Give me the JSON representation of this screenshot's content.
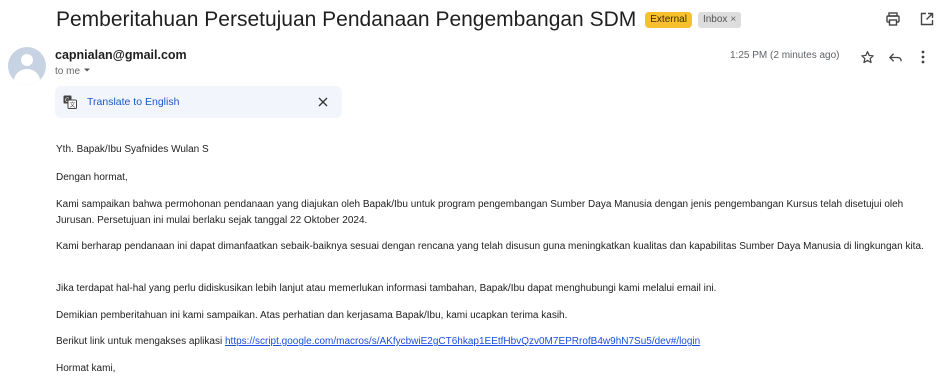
{
  "email": {
    "subject": "Pemberitahuan Persetujuan Pendanaan Pengembangan SDM",
    "labels": {
      "external": "External",
      "inbox": "Inbox"
    },
    "sender": "capnialan@gmail.com",
    "recipient": "to me",
    "time": "1:25 PM (2 minutes ago)",
    "translate": {
      "label": "Translate to English"
    },
    "body": {
      "greeting": "Yth. Bapak/Ibu Syafnides Wulan S",
      "salutation": "Dengan hormat,",
      "para1": "Kami sampaikan bahwa permohonan pendanaan yang diajukan oleh Bapak/Ibu untuk program pengembangan Sumber Daya Manusia dengan jenis pengembangan Kursus telah disetujui oleh Jurusan. Persetujuan ini mulai berlaku sejak tanggal 22 Oktober 2024.",
      "para2": "Kami berharap pendanaan ini dapat dimanfaatkan sebaik-baiknya sesuai dengan rencana yang telah disusun guna meningkatkan kualitas dan kapabilitas Sumber Daya Manusia di lingkungan kita.",
      "para3": "Jika terdapat hal-hal yang perlu didiskusikan lebih lanjut atau memerlukan informasi tambahan, Bapak/Ibu dapat menghubungi kami melalui email ini.",
      "para4": "Demikian pemberitahuan ini kami sampaikan. Atas perhatian dan kerjasama Bapak/Ibu, kami ucapkan terima kasih.",
      "link_prefix": "Berikut link untuk mengakses aplikasi ",
      "link_url": "https://script.google.com/macros/s/AKfycbwiE2gCT6hkap1EEtfHbvQzv0M7EPRrofB4w9hN7Su5/dev#/login",
      "closing": "Hormat kami,"
    }
  },
  "icons": {
    "print": "print-icon",
    "open_new_window": "open-in-new-window-icon",
    "star": "star-icon",
    "reply": "reply-icon",
    "more": "more-vert-icon",
    "translate": "translate-icon",
    "close": "close-icon",
    "dropdown": "chevron-down-icon"
  },
  "colors": {
    "external_badge": "#f6c12d",
    "inbox_badge": "#dddddd",
    "link": "#1a4ee0",
    "translate_bg": "#f2f6fc"
  }
}
